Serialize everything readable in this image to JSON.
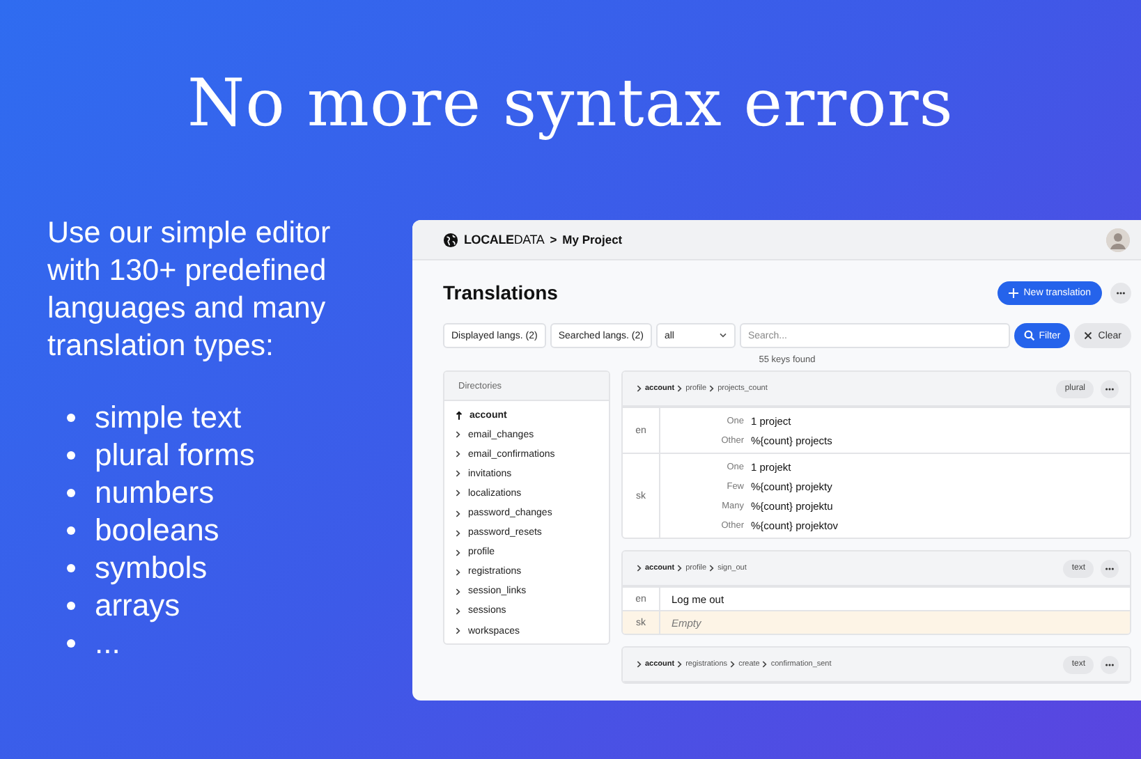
{
  "headline": "No more syntax errors",
  "intro": "Use our simple editor with 130+ predefined languages and many translation types:",
  "features": [
    "simple text",
    "plural forms",
    "numbers",
    "booleans",
    "symbols",
    "arrays",
    "..."
  ],
  "app": {
    "brand_bold": "LOCALE",
    "brand_light": "DATA",
    "breadcrumb_separator": ">",
    "project": "My Project",
    "page_title": "Translations",
    "new_button": "New translation",
    "filters": {
      "displayed": "Displayed langs. (2)",
      "searched": "Searched langs. (2)",
      "select_value": "all",
      "search_placeholder": "Search...",
      "filter_button": "Filter",
      "clear_button": "Clear"
    },
    "result_count": "55 keys found",
    "directories": {
      "title": "Directories",
      "items": [
        {
          "label": "account",
          "selected": true
        },
        {
          "label": "email_changes",
          "selected": false
        },
        {
          "label": "email_confirmations",
          "selected": false
        },
        {
          "label": "invitations",
          "selected": false
        },
        {
          "label": "localizations",
          "selected": false
        },
        {
          "label": "password_changes",
          "selected": false
        },
        {
          "label": "password_resets",
          "selected": false
        },
        {
          "label": "profile",
          "selected": false
        },
        {
          "label": "registrations",
          "selected": false
        },
        {
          "label": "session_links",
          "selected": false
        },
        {
          "label": "sessions",
          "selected": false
        },
        {
          "label": "workspaces",
          "selected": false
        }
      ]
    },
    "keys": [
      {
        "path": [
          "account",
          "profile",
          "projects_count"
        ],
        "type": "plural",
        "langs": [
          {
            "code": "en",
            "forms": [
              {
                "label": "One",
                "value": "1 project"
              },
              {
                "label": "Other",
                "value": "%{count} projects"
              }
            ]
          },
          {
            "code": "sk",
            "forms": [
              {
                "label": "One",
                "value": "1 projekt"
              },
              {
                "label": "Few",
                "value": "%{count} projekty"
              },
              {
                "label": "Many",
                "value": "%{count} projektu"
              },
              {
                "label": "Other",
                "value": "%{count} projektov"
              }
            ]
          }
        ]
      },
      {
        "path": [
          "account",
          "profile",
          "sign_out"
        ],
        "type": "text",
        "langs": [
          {
            "code": "en",
            "value": "Log me out",
            "empty": false
          },
          {
            "code": "sk",
            "value": "Empty",
            "empty": true
          }
        ]
      },
      {
        "path": [
          "account",
          "registrations",
          "create",
          "confirmation_sent"
        ],
        "type": "text"
      }
    ]
  }
}
